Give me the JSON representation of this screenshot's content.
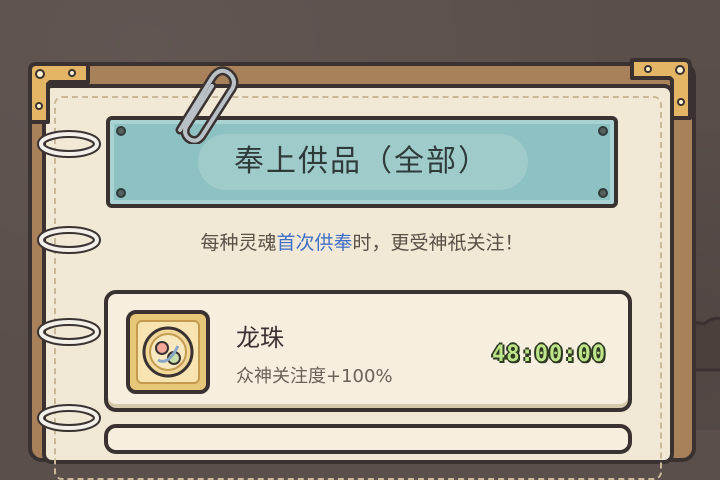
{
  "panel": {
    "title": "奉上供品（全部）",
    "subtitle_before": "每种灵魂",
    "subtitle_highlight": "首次供奉",
    "subtitle_after": "时，更受神祇关注！"
  },
  "offerings": [
    {
      "name": "龙珠",
      "effect": "众神关注度+100%",
      "timer": "48:00:00",
      "icon": "dragon-pearl-icon"
    }
  ],
  "colors": {
    "title_plaque": "#8ec1c2",
    "highlight": "#3f6fc8",
    "timer": "#bfe58a",
    "page": "#f1e9d6"
  }
}
